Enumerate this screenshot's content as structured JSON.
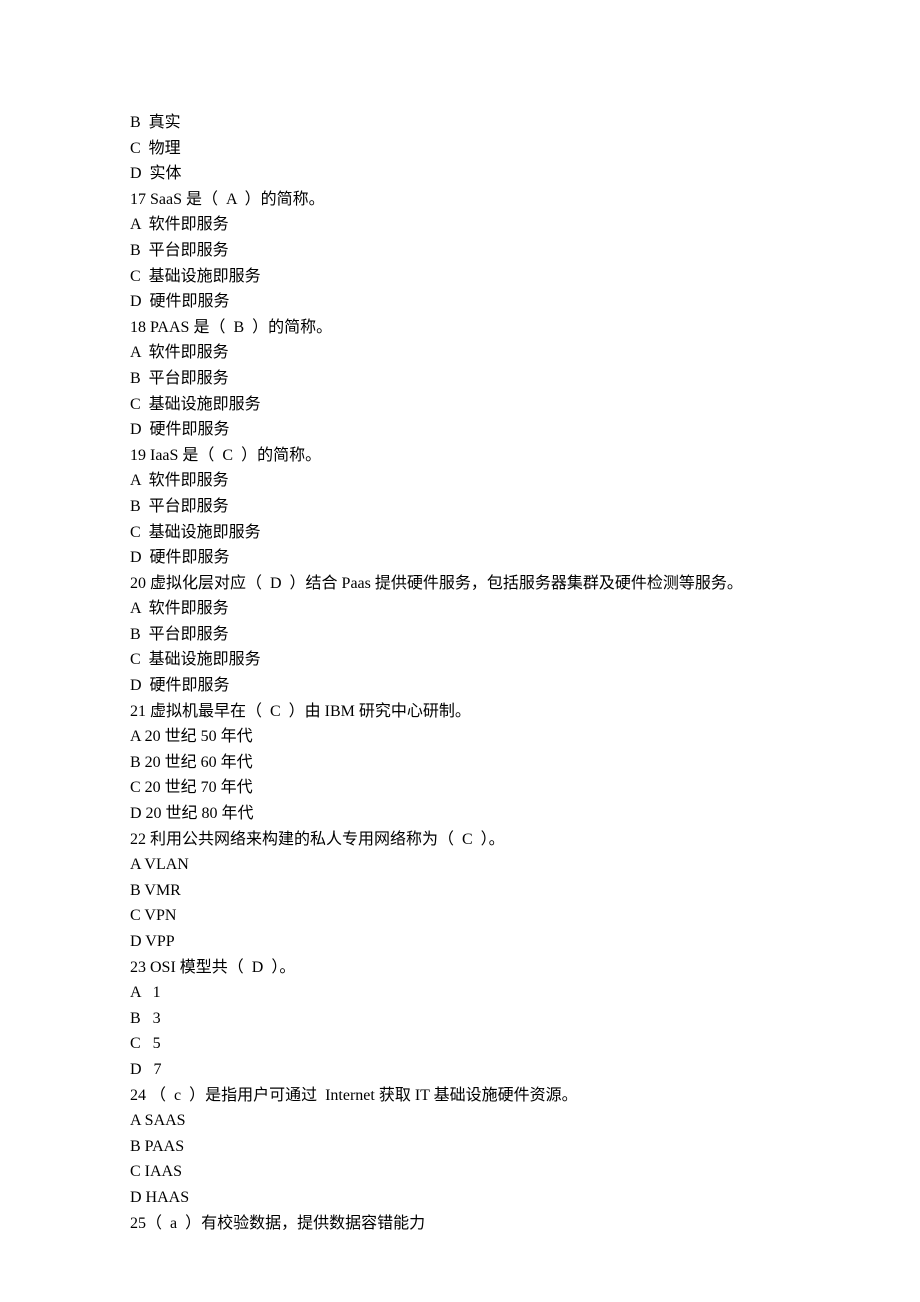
{
  "lines": [
    "B  真实",
    "C  物理",
    "D  实体",
    "17 SaaS 是（  A  ）的简称。",
    "A  软件即服务",
    "B  平台即服务",
    "C  基础设施即服务",
    "D  硬件即服务",
    "18 PAAS 是（  B  ）的简称。",
    "A  软件即服务",
    "B  平台即服务",
    "C  基础设施即服务",
    "D  硬件即服务",
    "19 IaaS 是（  C  ）的简称。",
    "A  软件即服务",
    "B  平台即服务",
    "C  基础设施即服务",
    "D  硬件即服务",
    "20 虚拟化层对应（  D  ）结合 Paas 提供硬件服务，包括服务器集群及硬件检测等服务。",
    "A  软件即服务",
    "B  平台即服务",
    "C  基础设施即服务",
    "D  硬件即服务",
    "21 虚拟机最早在（  C  ）由 IBM 研究中心研制。",
    "A 20 世纪 50 年代",
    "B 20 世纪 60 年代",
    "C 20 世纪 70 年代",
    "D 20 世纪 80 年代",
    "22 利用公共网络来构建的私人专用网络称为（  C  ）。",
    "A VLAN",
    "B VMR",
    "C VPN",
    "D VPP",
    "23 OSI 模型共（  D  ）。",
    "A   1",
    "B   3",
    "C   5",
    "D   7",
    "24 （  c  ）是指用户可通过  Internet 获取 IT 基础设施硬件资源。",
    "A SAAS",
    "B PAAS",
    "C IAAS",
    "D HAAS",
    "25（  a  ）有校验数据，提供数据容错能力"
  ]
}
